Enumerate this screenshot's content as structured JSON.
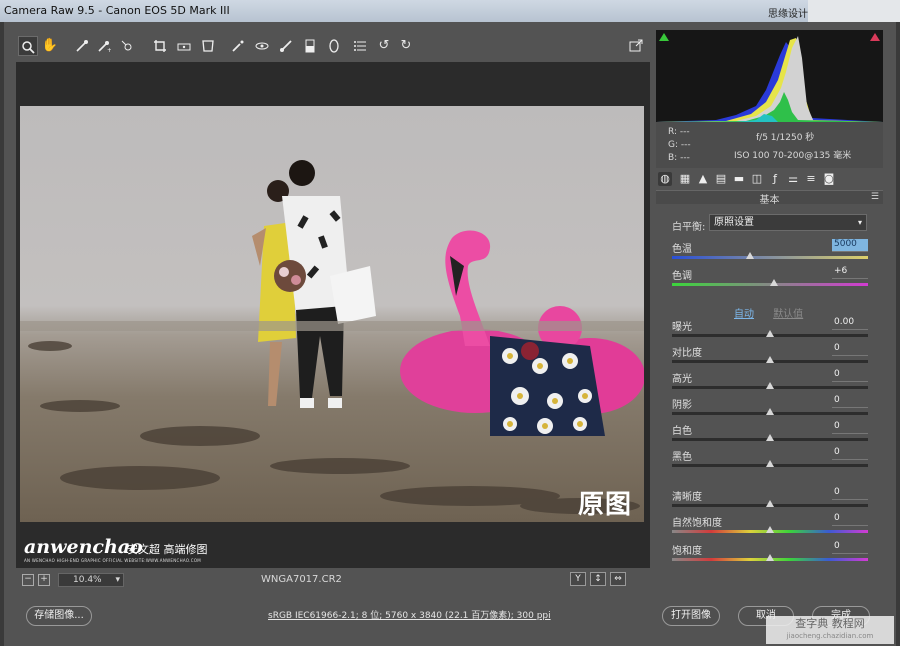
{
  "window": {
    "title": "Camera Raw 9.5 - Canon EOS 5D Mark III",
    "right_title": "思缘设计论"
  },
  "toolbar": {
    "tools": [
      "zoom-tool",
      "hand-tool",
      "white-balance-tool",
      "color-sampler-tool",
      "target-adjustment-tool",
      "crop-tool",
      "straighten-tool",
      "transform-tool",
      "spot-removal-tool",
      "red-eye-tool",
      "adjustment-brush-tool",
      "graduated-filter-tool",
      "radial-filter-tool",
      "preferences-tool",
      "rotate-ccw-tool",
      "rotate-cw-tool"
    ],
    "fullscreen_icon": "fullscreen-icon"
  },
  "preview": {
    "overlay_label": "原图",
    "watermark_script": "anwenchao",
    "watermark_cn": "安文超 高端修图",
    "watermark_sub": "AN WENCHAO HIGH-END GRAPHIC OFFICIAL WEBSITE:WWW.ANWENCHAO.COM"
  },
  "status": {
    "zoom": "10.4%",
    "filename": "WNGA7017.CR2",
    "view_buttons": [
      "Y",
      "↕",
      "⇔"
    ]
  },
  "histogram": {
    "clip_shadow_color": "#38c83a",
    "clip_highlight_color": "#d93a5a"
  },
  "info": {
    "r": "R: ---",
    "g": "G: ---",
    "b": "B: ---",
    "aperture_shutter": "f/5   1/1250 秒",
    "iso_lens": "ISO 100   70-200@135 毫米"
  },
  "panel": {
    "title": "基本",
    "wb_label": "白平衡:",
    "wb_value": "原照设置",
    "auto_label": "自动",
    "default_label": "默认值",
    "sliders": [
      {
        "label": "色温",
        "value": "5000",
        "pos": 0.4,
        "track": "temp",
        "selected": true
      },
      {
        "label": "色调",
        "value": "+6",
        "pos": 0.52,
        "track": "tint",
        "selected": false
      },
      {
        "label": "曝光",
        "value": "0.00",
        "pos": 0.5,
        "track": "plain",
        "selected": false
      },
      {
        "label": "对比度",
        "value": "0",
        "pos": 0.5,
        "track": "plain",
        "selected": false
      },
      {
        "label": "高光",
        "value": "0",
        "pos": 0.5,
        "track": "plain",
        "selected": false
      },
      {
        "label": "阴影",
        "value": "0",
        "pos": 0.5,
        "track": "plain",
        "selected": false
      },
      {
        "label": "白色",
        "value": "0",
        "pos": 0.5,
        "track": "plain",
        "selected": false
      },
      {
        "label": "黑色",
        "value": "0",
        "pos": 0.5,
        "track": "plain",
        "selected": false
      },
      {
        "label": "清晰度",
        "value": "0",
        "pos": 0.5,
        "track": "plain",
        "selected": false
      },
      {
        "label": "自然饱和度",
        "value": "0",
        "pos": 0.5,
        "track": "vib",
        "selected": false
      },
      {
        "label": "饱和度",
        "value": "0",
        "pos": 0.5,
        "track": "sat",
        "selected": false
      }
    ]
  },
  "buttons": {
    "save_image": "存储图像...",
    "workflow_link": "sRGB IEC61966-2.1; 8 位; 5760 x 3840 (22.1 百万像素); 300 ppi",
    "open_image": "打开图像",
    "cancel": "取消",
    "done": "完成"
  },
  "site_watermark": {
    "main": "查字典 教程网",
    "sub": "jiaocheng.chazidian.com"
  }
}
